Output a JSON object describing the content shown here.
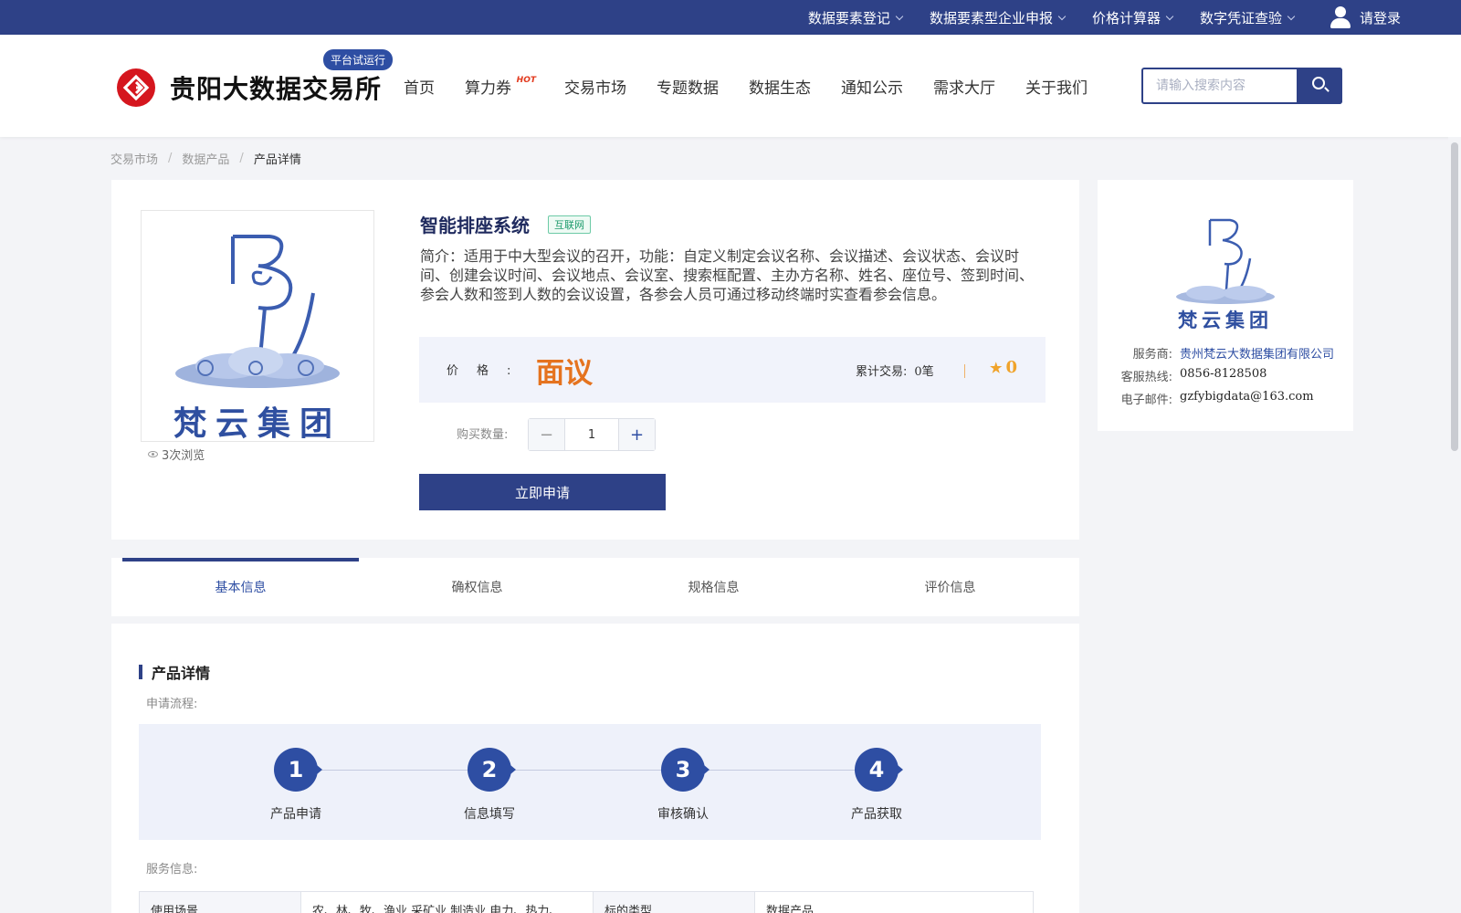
{
  "topbar": {
    "items": [
      {
        "label": "数据要素登记"
      },
      {
        "label": "数据要素型企业申报"
      },
      {
        "label": "价格计算器"
      },
      {
        "label": "数字凭证查验"
      }
    ],
    "login_label": "请登录"
  },
  "header": {
    "logo_text": "贵阳大数据交易所",
    "trial_badge": "平台试运行",
    "nav": [
      {
        "label": "首页"
      },
      {
        "label": "算力券",
        "tag": "HOT"
      },
      {
        "label": "交易市场"
      },
      {
        "label": "专题数据"
      },
      {
        "label": "数据生态"
      },
      {
        "label": "通知公示"
      },
      {
        "label": "需求大厅"
      },
      {
        "label": "关于我们"
      }
    ],
    "search_placeholder": "请输入搜索内容"
  },
  "breadcrumb": [
    "交易市场",
    "数据产品",
    "产品详情"
  ],
  "product": {
    "image_caption": "梵云集团",
    "views": "3次浏览",
    "title": "智能排座系统",
    "category_tag": "互联网",
    "summary": "简介：适用于中大型会议的召开，功能：自定义制定会议名称、会议描述、会议状态、会议时间、创建会议时间、会议地点、会议室、搜索框配置、主办方名称、姓名、座位号、签到时间、参会人数和签到人数的会议设置，各参会人员可通过移动终端时实查看参会信息。",
    "price_label": "价格:",
    "price_value": "面议",
    "deals_label": "累计交易:",
    "deals_value": "0笔",
    "rating": "0",
    "qty_label": "购买数量:",
    "qty_value": "1",
    "apply_label": "立即申请"
  },
  "vendor": {
    "logo_caption": "梵云集团",
    "rows": [
      {
        "key": "服务商:",
        "value": "贵州梵云大数据集团有限公司"
      },
      {
        "key": "客服热线:",
        "value": "0856-8128508"
      },
      {
        "key": "电子邮件:",
        "value": "gzfybigdata@163.com"
      }
    ]
  },
  "tabs": [
    {
      "label": "基本信息",
      "active": true
    },
    {
      "label": "确权信息"
    },
    {
      "label": "规格信息"
    },
    {
      "label": "评价信息"
    }
  ],
  "detail": {
    "title": "产品详情",
    "process_label": "申请流程:",
    "steps": [
      {
        "num": "1",
        "label": "产品申请"
      },
      {
        "num": "2",
        "label": "信息填写"
      },
      {
        "num": "3",
        "label": "审核确认"
      },
      {
        "num": "4",
        "label": "产品获取"
      }
    ],
    "service_label": "服务信息:",
    "table": [
      [
        "使用场景",
        "农、林、牧、渔业,采矿业,制造业,电力、热力、",
        "标的类型",
        "数据产品"
      ]
    ]
  },
  "colors": {
    "brand": "#2e4187",
    "accent": "#2e4ea3",
    "price": "#e5731f",
    "rating": "#f0a32b",
    "logo_red": "#d5161e"
  },
  "icons": [
    "chevron-down-icon",
    "user-icon",
    "search-icon",
    "eye-icon",
    "star-icon"
  ]
}
